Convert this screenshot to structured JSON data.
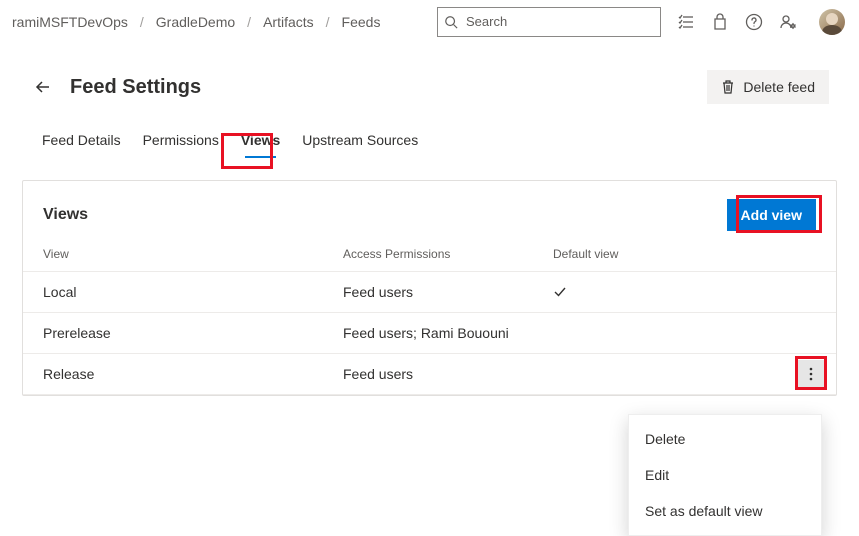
{
  "breadcrumbs": [
    "ramiMSFTDevOps",
    "GradleDemo",
    "Artifacts",
    "Feeds"
  ],
  "search": {
    "placeholder": "Search",
    "value": ""
  },
  "page": {
    "title": "Feed Settings"
  },
  "actions": {
    "delete_feed": "Delete feed"
  },
  "tabs": {
    "items": [
      {
        "label": "Feed Details",
        "active": false
      },
      {
        "label": "Permissions",
        "active": false
      },
      {
        "label": "Views",
        "active": true
      },
      {
        "label": "Upstream Sources",
        "active": false
      }
    ]
  },
  "views_panel": {
    "title": "Views",
    "add_button": "Add view",
    "columns": {
      "view": "View",
      "permissions": "Access Permissions",
      "default": "Default view"
    },
    "rows": [
      {
        "name": "Local",
        "permissions": "Feed users",
        "is_default": true
      },
      {
        "name": "Prerelease",
        "permissions": "Feed users; Rami Bououni",
        "is_default": false
      },
      {
        "name": "Release",
        "permissions": "Feed users",
        "is_default": false
      }
    ]
  },
  "context_menu": {
    "items": [
      {
        "label": "Delete"
      },
      {
        "label": "Edit"
      },
      {
        "label": "Set as default view"
      }
    ]
  },
  "icons": {
    "search": "search-icon",
    "list": "list-icon",
    "bag": "bag-icon",
    "help": "help-icon",
    "adminsettings": "admin-settings-icon",
    "back": "back-icon",
    "trash": "trash-icon",
    "more": "more-icon",
    "check": "check-icon"
  }
}
